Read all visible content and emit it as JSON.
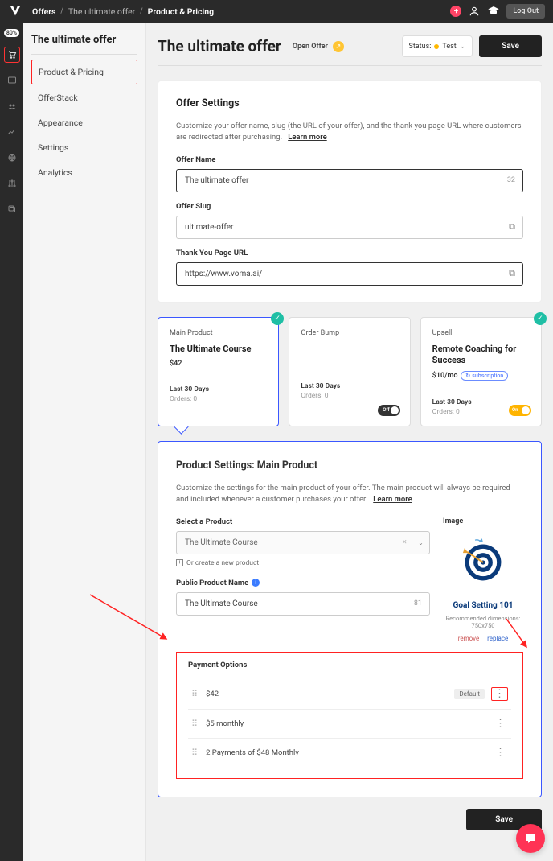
{
  "breadcrumb": {
    "root": "Offers",
    "parent": "The ultimate offer",
    "current": "Product & Pricing"
  },
  "topbar": {
    "logout": "Log Out",
    "badge": "80%"
  },
  "sidebar": {
    "title": "The ultimate offer",
    "items": [
      {
        "label": "Product & Pricing",
        "active": true
      },
      {
        "label": "OfferStack"
      },
      {
        "label": "Appearance"
      },
      {
        "label": "Settings"
      },
      {
        "label": "Analytics"
      }
    ]
  },
  "page": {
    "title": "The ultimate offer",
    "open_offer": "Open Offer",
    "status_label": "Status:",
    "status_value": "Test",
    "save": "Save"
  },
  "offer_settings": {
    "heading": "Offer Settings",
    "desc": "Customize your offer name, slug (the URL of your offer), and the thank you page URL where customers are redirected after purchasing.",
    "learn": "Learn more",
    "name_label": "Offer Name",
    "name_value": "The ultimate offer",
    "name_count": "32",
    "slug_label": "Offer Slug",
    "slug_value": "ultimate-offer",
    "thanks_label": "Thank You Page URL",
    "thanks_value": "https://www.voma.ai/"
  },
  "tabs": {
    "main": {
      "cat": "Main Product",
      "title": "The Ultimate Course",
      "price": "$42",
      "stats": "Last 30 Days",
      "orders": "Orders: 0"
    },
    "bump": {
      "cat": "Order Bump",
      "stats": "Last 30 Days",
      "orders": "Orders: 0",
      "toggle": "Off"
    },
    "upsell": {
      "cat": "Upsell",
      "title": "Remote Coaching for Success",
      "price": "$10/mo",
      "badge": "subscription",
      "stats": "Last 30 Days",
      "orders": "Orders: 0",
      "toggle": "On"
    }
  },
  "product_settings": {
    "heading": "Product Settings: Main Product",
    "desc": "Customize the settings for the main product of your offer. The main product will always be required and included whenever a customer purchases your offer.",
    "learn": "Learn more",
    "select_label": "Select a Product",
    "select_value": "The Ultimate Course",
    "create_link": "Or create a new product",
    "public_label": "Public Product Name",
    "public_value": "The Ultimate Course",
    "public_count": "81",
    "image_label": "Image",
    "image_caption": "Goal Setting 101",
    "image_meta": "Recommended dimensions: 750x750",
    "remove": "remove",
    "replace": "replace"
  },
  "payment": {
    "heading": "Payment Options",
    "rows": [
      {
        "label": "$42",
        "default": true
      },
      {
        "label": "$5 monthly"
      },
      {
        "label": "2 Payments of $48 Monthly"
      }
    ],
    "default_label": "Default"
  },
  "footer": {
    "save": "Save"
  }
}
